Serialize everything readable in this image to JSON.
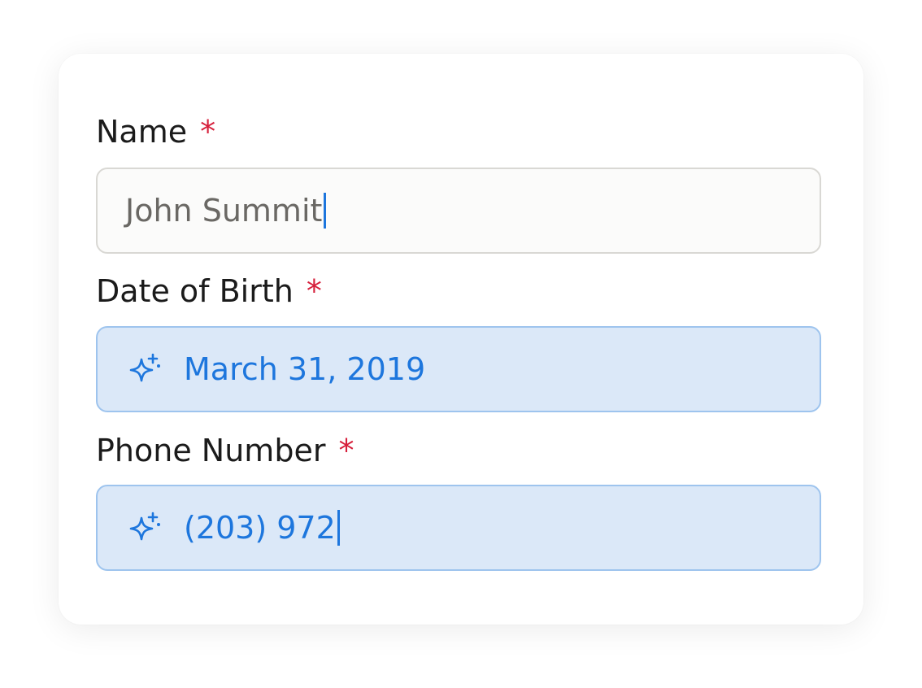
{
  "form": {
    "fields": [
      {
        "label": "Name",
        "required_marker": "*",
        "value": "John Summit",
        "state": "plain"
      },
      {
        "label": "Date of Birth",
        "required_marker": "*",
        "value": "March 31, 2019",
        "state": "ai-filled",
        "icon": "sparkle-icon"
      },
      {
        "label": "Phone Number",
        "required_marker": "*",
        "value": "(203) 972",
        "state": "ai-filled",
        "icon": "sparkle-icon"
      }
    ]
  },
  "colors": {
    "label_text": "#1b1b1b",
    "required": "#d61f3b",
    "ai_accent": "#1d76dd",
    "ai_background": "#dbe8f8",
    "ai_border": "#9ec4ee",
    "plain_border": "#d9d8d4",
    "plain_text": "#6a6864"
  }
}
